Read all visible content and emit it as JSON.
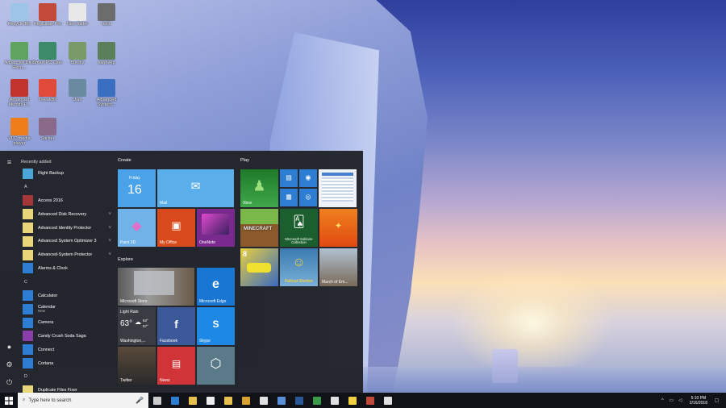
{
  "desktop_icons": [
    {
      "label": "Recycle Bin",
      "color": "#9ec5e8"
    },
    {
      "label": "RegClean Pro",
      "color": "#c24a3a"
    },
    {
      "label": "New folder",
      "color": "#e8e8e8"
    },
    {
      "label": "hello",
      "color": "#6c6c6c"
    },
    {
      "label": "Advanced Disk Reco...",
      "color": "#5fa35f"
    },
    {
      "label": "Smart PC Care",
      "color": "#3c8a6a"
    },
    {
      "label": "Bundle",
      "color": "#7a9a6a"
    },
    {
      "label": "sandeep",
      "color": "#5a7f5a"
    },
    {
      "label": "Advanced Identity P...",
      "color": "#c2332e"
    },
    {
      "label": "TweakBit",
      "color": "#e04a3a"
    },
    {
      "label": "User",
      "color": "#6a8aa0"
    },
    {
      "label": "Advanced System...",
      "color": "#3a6ec0"
    },
    {
      "label": "VLC media player",
      "color": "#ef7d1a"
    },
    {
      "label": "Sticker",
      "color": "#8a6a8a"
    }
  ],
  "start_menu": {
    "recently_added_label": "Recently added",
    "apps": [
      {
        "kind": "app",
        "label": "Right Backup",
        "color": "#4aa6d8"
      },
      {
        "kind": "letter",
        "label": "A"
      },
      {
        "kind": "app",
        "label": "Access 2016",
        "color": "#a4373a"
      },
      {
        "kind": "app",
        "label": "Advanced Disk Recovery",
        "color": "#e8d67a",
        "chev": "˅"
      },
      {
        "kind": "app",
        "label": "Advanced Identity Protector",
        "color": "#e8d67a",
        "chev": "˅"
      },
      {
        "kind": "app",
        "label": "Advanced System Optimizer 3",
        "color": "#e8d67a",
        "chev": "˅"
      },
      {
        "kind": "app",
        "label": "Advanced-System Protector",
        "color": "#e8d67a",
        "chev": "˅"
      },
      {
        "kind": "app",
        "label": "Alarms & Clock",
        "color": "#2d7dd2"
      },
      {
        "kind": "letter",
        "label": "C"
      },
      {
        "kind": "app",
        "label": "Calculator",
        "color": "#2d7dd2"
      },
      {
        "kind": "app",
        "label": "Calendar",
        "sub": "New",
        "color": "#2d7dd2"
      },
      {
        "kind": "app",
        "label": "Camera",
        "color": "#2d7dd2"
      },
      {
        "kind": "app",
        "label": "Candy Crush Soda Saga",
        "color": "#8a3fa8"
      },
      {
        "kind": "app",
        "label": "Connect",
        "color": "#2d7dd2"
      },
      {
        "kind": "app",
        "label": "Cortana",
        "color": "#2d7dd2"
      },
      {
        "kind": "letter",
        "label": "D"
      },
      {
        "kind": "app",
        "label": "Duplicate Files Fixer",
        "color": "#e8d67a"
      }
    ],
    "groups": {
      "create": "Create",
      "play": "Play",
      "explore": "Explore"
    },
    "tiles": {
      "calendar_day": "Friday",
      "calendar_date": "16",
      "mail": "Mail",
      "paint3d": "Paint 3D",
      "myoffice": "My Office",
      "onenote": "OneNote",
      "xbox": "Xbox",
      "minecraft": "MINECRAFT",
      "solitaire": "Microsoft Solitaire Collection",
      "racing": "8",
      "fallout": "Fallout Shelter",
      "empires": "March of Em...",
      "store": "Microsoft Store",
      "edge": "Microsoft Edge",
      "weather_cond": "Light Rain",
      "weather_temp": "63°",
      "weather_hi": "63°",
      "weather_lo": "57°",
      "weather_city": "Washington,...",
      "facebook": "Facebook",
      "skype": "Skype",
      "twitter": "Twitter",
      "news": "News"
    }
  },
  "taskbar": {
    "search_placeholder": "Type here to search",
    "time": "5:10 PM",
    "date": "2/16/2018",
    "icons": [
      {
        "name": "task-view",
        "color": "#cccccc"
      },
      {
        "name": "edge",
        "color": "#2d7dd2"
      },
      {
        "name": "file-explorer",
        "color": "#e8c050"
      },
      {
        "name": "store",
        "color": "#eeeeee"
      },
      {
        "name": "folder",
        "color": "#e8c050"
      },
      {
        "name": "chrome",
        "color": "#d9a030"
      },
      {
        "name": "mail",
        "color": "#e0e0e0"
      },
      {
        "name": "sticky",
        "color": "#5a8fd8"
      },
      {
        "name": "word",
        "color": "#2b5797"
      },
      {
        "name": "app",
        "color": "#3b9a4a"
      },
      {
        "name": "calculator",
        "color": "#e0e0e0"
      },
      {
        "name": "notes",
        "color": "#f0d040"
      },
      {
        "name": "paint",
        "color": "#c24a3a"
      },
      {
        "name": "settings",
        "color": "#e0e0e0"
      }
    ]
  }
}
